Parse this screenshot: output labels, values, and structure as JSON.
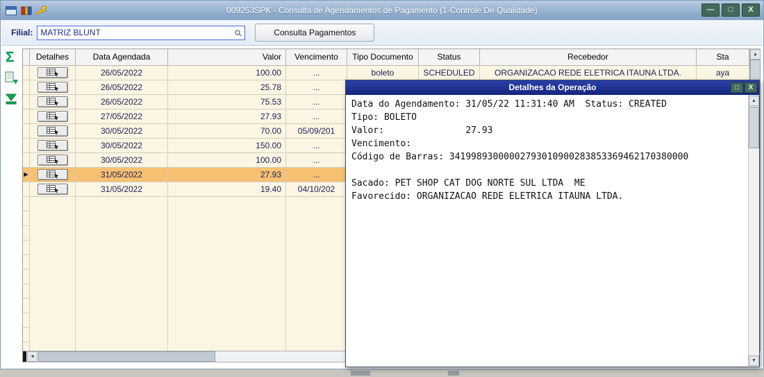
{
  "window": {
    "title": "009253SPK - Consulta de Agendamentos de Pagamento (1-Controle De Qualidade)",
    "minimize": "—",
    "maximize": "□",
    "close": "X"
  },
  "toolbar": {
    "filial_label": "Filial:",
    "filial_value": "MATRIZ BLUNT",
    "consulta_button": "Consulta Pagamentos"
  },
  "side_icons": {
    "sigma": "Σ"
  },
  "icons": {
    "up": "▲",
    "down": "▼",
    "left": "◄",
    "right": "►",
    "row_pointer": "▶"
  },
  "grid": {
    "columns": {
      "detalhes": "Detalhes",
      "data_agendada": "Data Agendada",
      "valor": "Valor",
      "vencimento": "Vencimento",
      "tipo_documento": "Tipo Documento",
      "status": "Status",
      "recebedor": "Recebedor",
      "sta": "Sta"
    },
    "rows": [
      {
        "data": "26/05/2022",
        "valor": "100.00",
        "vencimento": "...",
        "tipo": "boleto",
        "status": "SCHEDULED",
        "recebedor": "ORGANIZACAO REDE ELETRICA ITAUNA LTDA.",
        "sta": "aya",
        "selected": false
      },
      {
        "data": "26/05/2022",
        "valor": "25.78",
        "vencimento": "...",
        "tipo": "",
        "status": "",
        "recebedor": "",
        "sta": "",
        "selected": false
      },
      {
        "data": "26/05/2022",
        "valor": "75.53",
        "vencimento": "...",
        "tipo": "",
        "status": "",
        "recebedor": "",
        "sta": "",
        "selected": false
      },
      {
        "data": "27/05/2022",
        "valor": "27.93",
        "vencimento": "...",
        "tipo": "",
        "status": "",
        "recebedor": "",
        "sta": "",
        "selected": false
      },
      {
        "data": "30/05/2022",
        "valor": "70.00",
        "vencimento": "05/09/201",
        "tipo": "",
        "status": "",
        "recebedor": "",
        "sta": "",
        "selected": false
      },
      {
        "data": "30/05/2022",
        "valor": "150.00",
        "vencimento": "...",
        "tipo": "",
        "status": "",
        "recebedor": "",
        "sta": "",
        "selected": false
      },
      {
        "data": "30/05/2022",
        "valor": "100.00",
        "vencimento": "...",
        "tipo": "",
        "status": "",
        "recebedor": "",
        "sta": "",
        "selected": false
      },
      {
        "data": "31/05/2022",
        "valor": "27.93",
        "vencimento": "...",
        "tipo": "",
        "status": "",
        "recebedor": "",
        "sta": "",
        "selected": true
      },
      {
        "data": "31/05/2022",
        "valor": "19.40",
        "vencimento": "04/10/202",
        "tipo": "",
        "status": "",
        "recebedor": "",
        "sta": "",
        "selected": false
      }
    ]
  },
  "dialog": {
    "title": "Detalhes da Operação",
    "maximize": "□",
    "close": "X",
    "lines": [
      "Data do Agendamento: 31/05/22 11:31:40 AM  Status: CREATED",
      "Tipo: BOLETO",
      "Valor:               27.93",
      "Vencimento:",
      "Código de Barras: 34199893000002793010900283853369462170380000",
      "",
      "Sacado: PET SHOP CAT DOG NORTE SUL LTDA  ME",
      "Favorecido: ORGANIZACAO REDE ELETRICA ITAUNA LTDA."
    ]
  },
  "colors": {
    "titlebar": "#93aecd",
    "dialog_titlebar": "#1b2d91",
    "selected_row": "#f7c173",
    "grid_background": "#fbf6e4",
    "accent_green": "#0d9a62"
  }
}
